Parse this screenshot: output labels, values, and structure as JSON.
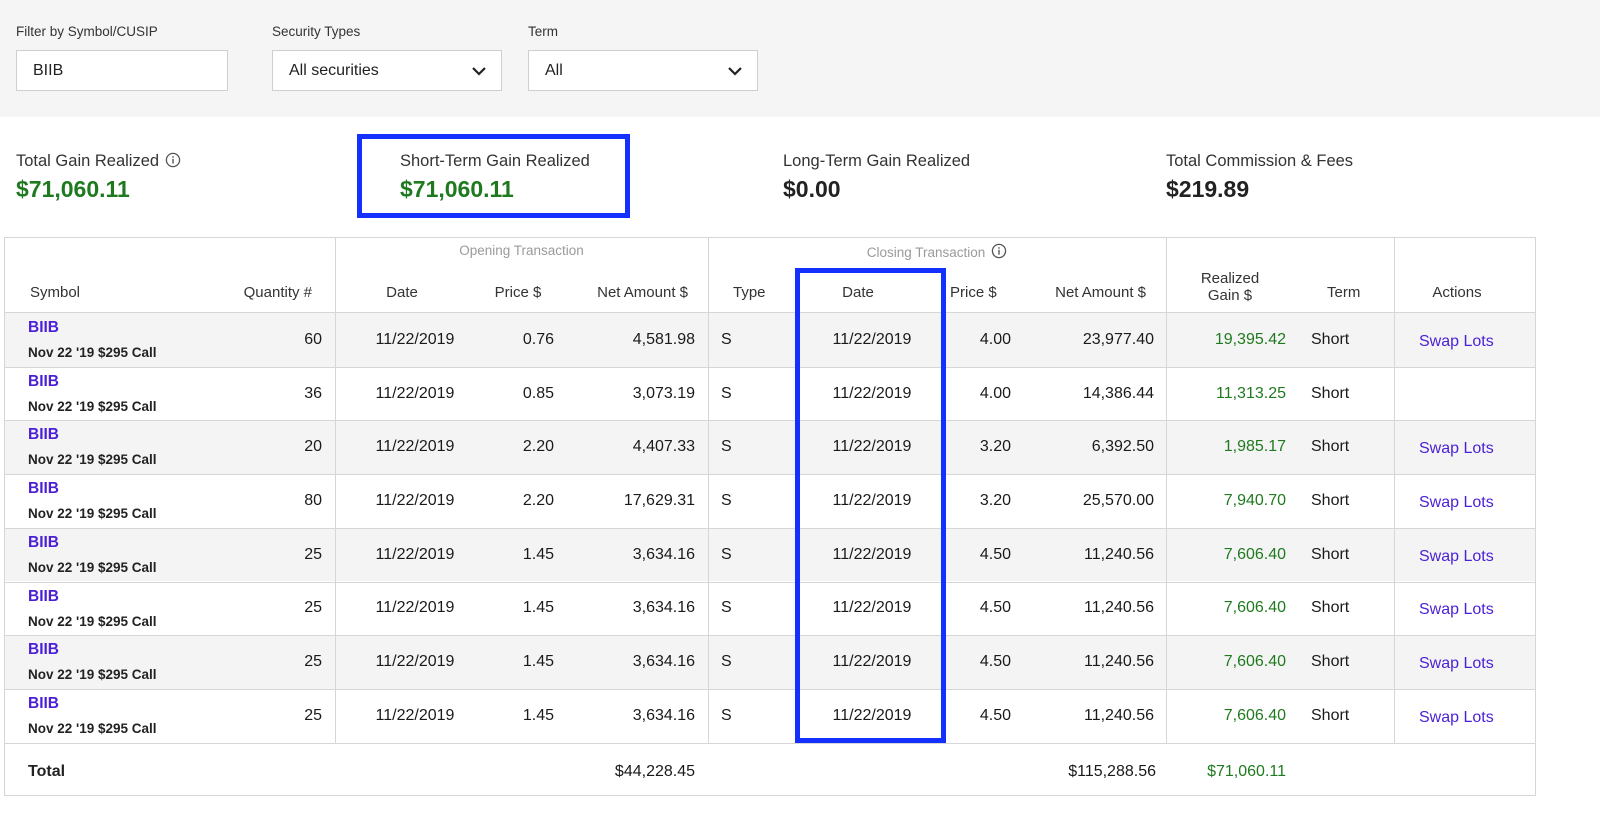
{
  "filters": {
    "symbol_label": "Filter by Symbol/CUSIP",
    "symbol_value": "BIIB",
    "security_label": "Security Types",
    "security_value": "All securities",
    "term_label": "Term",
    "term_value": "All"
  },
  "summary": {
    "total_label": "Total Gain Realized",
    "total_value": "$71,060.11",
    "short_label": "Short-Term Gain Realized",
    "short_value": "$71,060.11",
    "long_label": "Long-Term Gain Realized",
    "long_value": "$0.00",
    "fees_label": "Total Commission & Fees",
    "fees_value": "$219.89"
  },
  "table": {
    "group_opening": "Opening Transaction",
    "group_closing": "Closing Transaction",
    "headers": {
      "symbol": "Symbol",
      "quantity": "Quantity #",
      "open_date": "Date",
      "open_price": "Price $",
      "open_net": "Net Amount $",
      "type": "Type",
      "close_date": "Date",
      "close_price": "Price $",
      "close_net": "Net Amount $",
      "gain_line1": "Realized",
      "gain_line2": "Gain $",
      "term": "Term",
      "actions": "Actions"
    },
    "rows": [
      {
        "symbol": "BIIB",
        "desc": "Nov 22 '19 $295 Call",
        "qty": "60",
        "open_date": "11/22/2019",
        "open_price": "0.76",
        "open_net": "4,581.98",
        "type": "S",
        "close_date": "11/22/2019",
        "close_price": "4.00",
        "close_net": "23,977.40",
        "gain": "19,395.42",
        "term": "Short",
        "action": "Swap Lots"
      },
      {
        "symbol": "BIIB",
        "desc": "Nov 22 '19 $295 Call",
        "qty": "36",
        "open_date": "11/22/2019",
        "open_price": "0.85",
        "open_net": "3,073.19",
        "type": "S",
        "close_date": "11/22/2019",
        "close_price": "4.00",
        "close_net": "14,386.44",
        "gain": "11,313.25",
        "term": "Short",
        "action": ""
      },
      {
        "symbol": "BIIB",
        "desc": "Nov 22 '19 $295 Call",
        "qty": "20",
        "open_date": "11/22/2019",
        "open_price": "2.20",
        "open_net": "4,407.33",
        "type": "S",
        "close_date": "11/22/2019",
        "close_price": "3.20",
        "close_net": "6,392.50",
        "gain": "1,985.17",
        "term": "Short",
        "action": "Swap Lots"
      },
      {
        "symbol": "BIIB",
        "desc": "Nov 22 '19 $295 Call",
        "qty": "80",
        "open_date": "11/22/2019",
        "open_price": "2.20",
        "open_net": "17,629.31",
        "type": "S",
        "close_date": "11/22/2019",
        "close_price": "3.20",
        "close_net": "25,570.00",
        "gain": "7,940.70",
        "term": "Short",
        "action": "Swap Lots"
      },
      {
        "symbol": "BIIB",
        "desc": "Nov 22 '19 $295 Call",
        "qty": "25",
        "open_date": "11/22/2019",
        "open_price": "1.45",
        "open_net": "3,634.16",
        "type": "S",
        "close_date": "11/22/2019",
        "close_price": "4.50",
        "close_net": "11,240.56",
        "gain": "7,606.40",
        "term": "Short",
        "action": "Swap Lots"
      },
      {
        "symbol": "BIIB",
        "desc": "Nov 22 '19 $295 Call",
        "qty": "25",
        "open_date": "11/22/2019",
        "open_price": "1.45",
        "open_net": "3,634.16",
        "type": "S",
        "close_date": "11/22/2019",
        "close_price": "4.50",
        "close_net": "11,240.56",
        "gain": "7,606.40",
        "term": "Short",
        "action": "Swap Lots"
      },
      {
        "symbol": "BIIB",
        "desc": "Nov 22 '19 $295 Call",
        "qty": "25",
        "open_date": "11/22/2019",
        "open_price": "1.45",
        "open_net": "3,634.16",
        "type": "S",
        "close_date": "11/22/2019",
        "close_price": "4.50",
        "close_net": "11,240.56",
        "gain": "7,606.40",
        "term": "Short",
        "action": "Swap Lots"
      },
      {
        "symbol": "BIIB",
        "desc": "Nov 22 '19 $295 Call",
        "qty": "25",
        "open_date": "11/22/2019",
        "open_price": "1.45",
        "open_net": "3,634.16",
        "type": "S",
        "close_date": "11/22/2019",
        "close_price": "4.50",
        "close_net": "11,240.56",
        "gain": "7,606.40",
        "term": "Short",
        "action": "Swap Lots"
      }
    ],
    "total": {
      "label": "Total",
      "open_net": "$44,228.45",
      "close_net": "$115,288.56",
      "gain": "$71,060.11"
    }
  },
  "colors": {
    "highlight": "#1430ff",
    "link": "#4a1fd6",
    "gain": "#1f7a1f"
  }
}
